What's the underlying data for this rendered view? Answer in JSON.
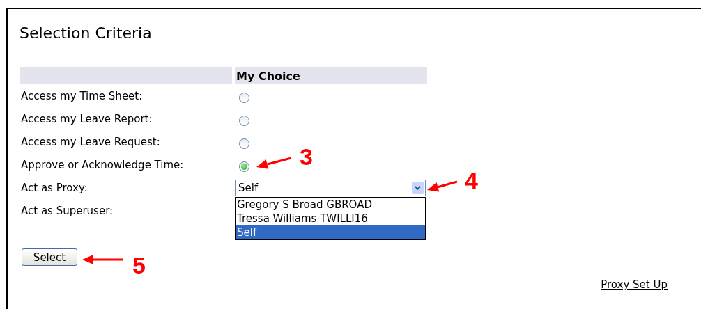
{
  "title": "Selection Criteria",
  "table": {
    "column_header": "My Choice",
    "rows": [
      {
        "label": "Access my Time Sheet:",
        "kind": "radio",
        "selected": false
      },
      {
        "label": "Access my Leave Report:",
        "kind": "radio",
        "selected": false
      },
      {
        "label": "Access my Leave Request:",
        "kind": "radio",
        "selected": false
      },
      {
        "label": "Approve or Acknowledge Time:",
        "kind": "radio",
        "selected": true
      },
      {
        "label": "Act as Proxy:",
        "kind": "select",
        "value": "Self",
        "expanded": true,
        "options": [
          {
            "label": "Gregory S Broad GBROAD",
            "selected": false
          },
          {
            "label": "Tressa Williams TWILLI16",
            "selected": false
          },
          {
            "label": "Self",
            "selected": true
          }
        ]
      },
      {
        "label": "Act as Superuser:",
        "kind": "hidden"
      }
    ]
  },
  "button": "Select",
  "link": "Proxy Set Up",
  "annotations": [
    {
      "label": "3"
    },
    {
      "label": "4"
    },
    {
      "label": "5"
    }
  ]
}
